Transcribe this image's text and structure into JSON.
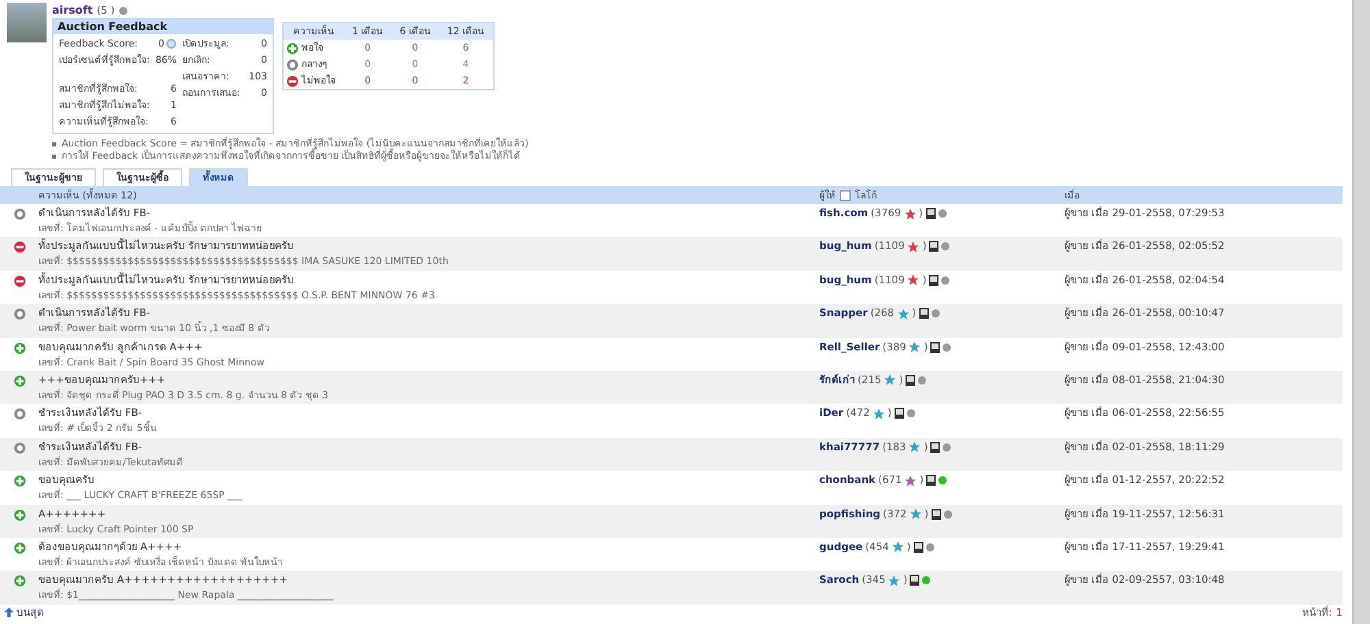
{
  "profile": {
    "username": "airsoft",
    "count": "(5 )",
    "online": false
  },
  "auction_feedback": {
    "title": "Auction Feedback",
    "left": [
      {
        "label": "Feedback Score:",
        "value": "0",
        "help": true
      },
      {
        "label": "เปอร์เซนต์ที่รู้สึกพอใจ:",
        "value": "86%",
        "help": false
      },
      {
        "label": "สมาชิกที่รู้สึกพอใจ:",
        "value": "6",
        "help": false
      },
      {
        "label": "สมาชิกที่รู้สึกไม่พอใจ:",
        "value": "1",
        "help": false
      },
      {
        "label": "ความเห็นที่รู้สึกพอใจ:",
        "value": "6",
        "help": false
      }
    ],
    "right": [
      {
        "label": "เปิดประมูล:",
        "value": "0"
      },
      {
        "label": "ยกเลิก:",
        "value": "0"
      },
      {
        "label": "เสนอราคา:",
        "value": "103"
      },
      {
        "label": "ถอนการเสนอ:",
        "value": "0"
      }
    ]
  },
  "summary": {
    "columns": [
      "ความเห็น",
      "1 เดือน",
      "6 เดือน",
      "12 เดือน"
    ],
    "rows": [
      {
        "kind": "positive",
        "label": "พอใจ",
        "values": [
          "0",
          "0",
          "6"
        ]
      },
      {
        "kind": "neutral",
        "label": "กลางๆ",
        "values": [
          "0",
          "0",
          "4"
        ]
      },
      {
        "kind": "negative",
        "label": "ไม่พอใจ",
        "values": [
          "0",
          "0",
          "2"
        ]
      }
    ]
  },
  "notes": [
    "Auction Feedback Score = สมาชิกที่รู้สึกพอใจ - สมาชิกที่รู้สึกไม่พอใจ (ไม่นับคะแนนจากสมาชิกที่เคยให้แล้ว)",
    "การให้ Feedback เป็นการแสดงความพึงพอใจที่เกิดจากการซื้อขาย เป็นสิทธิที่ผู้ซื้อหรือผู้ขายจะให้หรือไม่ให้ก็ได้"
  ],
  "tabs": [
    {
      "label": "ในฐานะผู้ขาย",
      "selected": false
    },
    {
      "label": "ในฐานะผู้ซื้อ",
      "selected": false
    },
    {
      "label": "ทั้งหมด",
      "selected": true
    }
  ],
  "table": {
    "columns": {
      "comment": "ความเห็น (ทั้งหมด 12)",
      "giver": "ผู้ให้",
      "logo_checkbox": {
        "label": "โลโก้",
        "checked": false
      },
      "when": "เมื่อ"
    },
    "rows": [
      {
        "kind": "neutral",
        "comment": "ดำเนินการหลังได้รับ FB-",
        "item": "เลขที่: โคมไฟเอนกประสงค์ - แค้มป์ปิ้ง ตกปลา ไฟฉาย",
        "user": "fish.com",
        "score": "(3769",
        "score_close": ")",
        "color": "#e03a4a",
        "online": false,
        "date": "ผู้ขาย เมื่อ 29-01-2558, 07:29:53"
      },
      {
        "kind": "negative",
        "comment": "ทั้งประมูลกันแบบนี้ไม่ไหวนะครับ รักษามารยาทหน่อยครับ",
        "item": "เลขที่: $$$$$$$$$$$$$$$$$$$$$$$$$$$$$$$$$$$$$$ IMA SASUKE 120 LIMITED 10th",
        "user": "bug_hum",
        "score": "(1109",
        "score_close": ")",
        "color": "#e03a4a",
        "online": false,
        "date": "ผู้ขาย เมื่อ 26-01-2558, 02:05:52"
      },
      {
        "kind": "negative",
        "comment": "ทั้งประมูลกันแบบนี้ไม่ไหวนะครับ รักษามารยาทหน่อยครับ",
        "item": "เลขที่: $$$$$$$$$$$$$$$$$$$$$$$$$$$$$$$$$$$$$$ O.S.P. BENT MINNOW 76 #3",
        "user": "bug_hum",
        "score": "(1109",
        "score_close": ")",
        "color": "#e03a4a",
        "online": false,
        "date": "ผู้ขาย เมื่อ 26-01-2558, 02:04:54"
      },
      {
        "kind": "neutral",
        "comment": "ดำเนินการหลังได้รับ FB-",
        "item": "เลขที่: Power bait worm ขนาด 10 นิ้ว ,1 ซองมี 8 ตัว",
        "user": "Snapper",
        "score": "(268",
        "score_close": ")",
        "color": "#2fa8c8",
        "online": false,
        "date": "ผู้ขาย เมื่อ 26-01-2558, 00:10:47"
      },
      {
        "kind": "positive",
        "comment": "ขอบคุณมากครับ ลูกค้าเกรด A+++",
        "item": "เลขที่: Crank Bait / Spin Board 35 Ghost Minnow",
        "user": "Rell_Seller",
        "score": "(389",
        "score_close": ")",
        "color": "#2fa8c8",
        "online": false,
        "date": "ผู้ขาย เมื่อ 09-01-2558, 12:43:00"
      },
      {
        "kind": "positive",
        "comment": "+++ขอบคุณมากครับ+++",
        "item": "เลขที่: จัดชุด กระดี่ Plug PAO 3 D 3.5 cm. 8 g. จำนวน 8 ตัว ชุด 3",
        "user": "รักต์เก่า",
        "score": "(215",
        "score_close": ")",
        "color": "#2fa8c8",
        "online": false,
        "date": "ผู้ขาย เมื่อ 08-01-2558, 21:04:30"
      },
      {
        "kind": "neutral",
        "comment": "ชำระเงินหลังได้รับ FB-",
        "item": "เลขที่: # เบ็ดจิ๋ว 2 กรัม 5ชิ้น",
        "user": "iDer",
        "score": "(472",
        "score_close": ")",
        "color": "#2fa8c8",
        "online": false,
        "date": "ผู้ขาย เมื่อ 06-01-2558, 22:56:55"
      },
      {
        "kind": "neutral",
        "comment": "ชำระเงินหลังได้รับ FB-",
        "item": "เลขที่: มีดพับสวยคม/Tekutaทัศมดี",
        "user": "khai77777",
        "score": "(183",
        "score_close": ")",
        "color": "#2fa8c8",
        "online": false,
        "date": "ผู้ขาย เมื่อ 02-01-2558, 18:11:29"
      },
      {
        "kind": "positive",
        "comment": "ขอบคุณครับ",
        "item": "เลขที่: ___ LUCKY CRAFT B'FREEZE 65SP ___",
        "user": "chonbank",
        "score": "(671",
        "score_close": ")",
        "color": "#b05ab8",
        "online": true,
        "date": "ผู้ขาย เมื่อ 01-12-2557, 20:22:52"
      },
      {
        "kind": "positive",
        "comment": "A+++++++",
        "item": "เลขที่: Lucky Craft Pointer 100 SP",
        "user": "popfishing",
        "score": "(372",
        "score_close": ")",
        "color": "#2fa8c8",
        "online": false,
        "date": "ผู้ขาย เมื่อ 19-11-2557, 12:56:31"
      },
      {
        "kind": "positive",
        "comment": "ต้องขอบคุณมากๆด้วย A++++",
        "item": "เลขที่: ผ้าเอนกประสงค์ ซับเหงื่อ เช็ดหน้า บังแดด พันใบหน้า",
        "user": "gudgee",
        "score": "(454",
        "score_close": ")",
        "color": "#2fa8c8",
        "online": false,
        "date": "ผู้ขาย เมื่อ 17-11-2557, 19:29:41"
      },
      {
        "kind": "positive",
        "comment": "ขอบคุณมากครับ A+++++++++++++++++++",
        "item": "เลขที่: $1____________________ New Rapala ____________________",
        "user": "Saroch",
        "score": "(345",
        "score_close": ")",
        "color": "#2fa8c8",
        "online": true,
        "date": "ผู้ขาย เมื่อ 02-09-2557, 03:10:48"
      }
    ]
  },
  "footer": {
    "top_link": "บนสุด",
    "page_label": "หน้าที่:",
    "page": "1"
  }
}
